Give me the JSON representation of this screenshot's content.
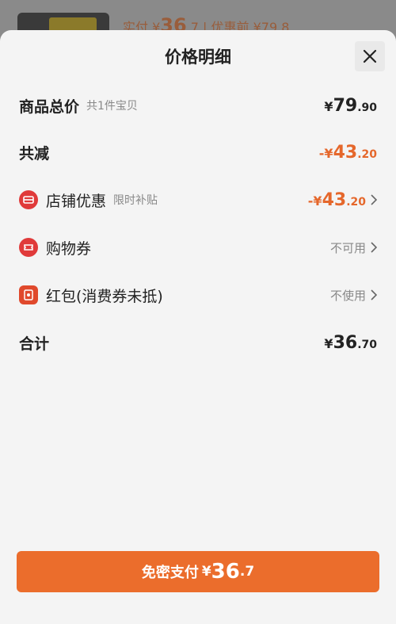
{
  "background": {
    "paid_label": "实付",
    "paid_amount": "36",
    "paid_decimal": ".7",
    "original_label": "优惠前 ¥79.8"
  },
  "sheet": {
    "title": "价格明细",
    "rows": [
      {
        "label": "商品总价",
        "sub": "共1件宝贝",
        "yen": "¥",
        "int": "79",
        "dec": ".90"
      },
      {
        "label": "共减",
        "prefix": "-",
        "yen": "¥",
        "int": "43",
        "dec": ".20"
      },
      {
        "label": "店铺优惠",
        "sub": "限时补贴",
        "prefix": "-",
        "yen": "¥",
        "int": "43",
        "dec": ".20"
      },
      {
        "label": "购物券",
        "status": "不可用"
      },
      {
        "label": "红包(消费券未抵)",
        "status": "不使用"
      },
      {
        "label": "合计",
        "yen": "¥",
        "int": "36",
        "dec": ".70"
      }
    ]
  },
  "pay_button": {
    "label": "免密支付",
    "yen": "¥",
    "int": "36",
    "dec": ".7"
  },
  "colors": {
    "accent": "#eb6d2c",
    "discount": "#e5672b",
    "icon_red": "#e03a3a"
  }
}
